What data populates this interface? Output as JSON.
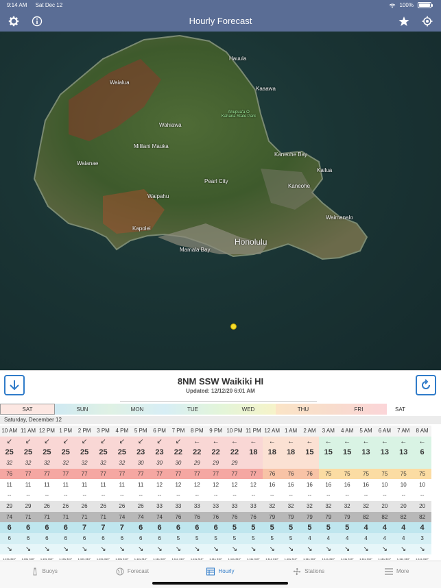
{
  "status_bar": {
    "time": "9:14 AM",
    "date": "Sat Dec 12",
    "battery": "100%"
  },
  "nav": {
    "title": "Hourly Forecast"
  },
  "map": {
    "labels": [
      {
        "text": "Hauula",
        "cls": ""
      },
      {
        "text": "Waialua",
        "cls": ""
      },
      {
        "text": "Kaaawa",
        "cls": ""
      },
      {
        "text": "Ahupua'a O Kahana State Park",
        "cls": "park"
      },
      {
        "text": "Wahiawa",
        "cls": ""
      },
      {
        "text": "Mililani Mauka",
        "cls": ""
      },
      {
        "text": "Kaneohe Bay",
        "cls": ""
      },
      {
        "text": "Waianae",
        "cls": ""
      },
      {
        "text": "Kailua",
        "cls": ""
      },
      {
        "text": "Pearl City",
        "cls": ""
      },
      {
        "text": "Kaneohe",
        "cls": ""
      },
      {
        "text": "Waipahu",
        "cls": ""
      },
      {
        "text": "Waimanalo",
        "cls": ""
      },
      {
        "text": "Kapolei",
        "cls": ""
      },
      {
        "text": "Honolulu",
        "cls": "big"
      },
      {
        "text": "Mamala Bay",
        "cls": ""
      }
    ],
    "highways": [
      "H2",
      "H3",
      "H1",
      "H201"
    ]
  },
  "station": {
    "name": "8NM SSW Waikiki HI",
    "updated": "Updated: 12/12/20 6:01 AM"
  },
  "days": [
    "SAT",
    "SUN",
    "MON",
    "TUE",
    "WED",
    "THU",
    "FRI",
    "SAT"
  ],
  "date_label": "Saturday, December 12",
  "table": {
    "hours": [
      "10 AM",
      "11 AM",
      "12 PM",
      "1 PM",
      "2 PM",
      "3 PM",
      "4 PM",
      "5 PM",
      "6 PM",
      "7 PM",
      "8 PM",
      "9 PM",
      "10 PM",
      "11 PM",
      "12 AM",
      "1 AM",
      "2 AM",
      "3 AM",
      "4 AM",
      "5 AM",
      "6 AM",
      "7 AM",
      "8 AM"
    ],
    "wind_dir": [
      "↙",
      "↙",
      "↙",
      "↙",
      "↙",
      "↙",
      "↙",
      "↙",
      "↙",
      "↙",
      "←",
      "←",
      "←",
      "←",
      "←",
      "←",
      "←",
      "←",
      "←",
      "←",
      "←",
      "←",
      "←"
    ],
    "wind_speed": [
      "25",
      "25",
      "25",
      "25",
      "25",
      "25",
      "25",
      "23",
      "23",
      "22",
      "22",
      "22",
      "22",
      "18",
      "18",
      "18",
      "15",
      "15",
      "15",
      "13",
      "13",
      "13",
      "6"
    ],
    "wind_gust": [
      "32",
      "32",
      "32",
      "32",
      "32",
      "32",
      "32",
      "30",
      "30",
      "30",
      "29",
      "29",
      "29",
      "",
      "",
      "",
      "",
      "",
      "",
      "",
      "",
      "",
      ""
    ],
    "air_temp": [
      "76",
      "77",
      "77",
      "77",
      "77",
      "77",
      "77",
      "77",
      "77",
      "77",
      "77",
      "77",
      "77",
      "77",
      "76",
      "76",
      "76",
      "75",
      "75",
      "75",
      "75",
      "75",
      "75"
    ],
    "row5": [
      "11",
      "11",
      "11",
      "11",
      "11",
      "11",
      "11",
      "11",
      "12",
      "12",
      "12",
      "12",
      "12",
      "12",
      "16",
      "16",
      "16",
      "16",
      "16",
      "16",
      "10",
      "10",
      "10"
    ],
    "row6": [
      "--",
      "--",
      "--",
      "--",
      "--",
      "--",
      "--",
      "--",
      "--",
      "--",
      "--",
      "--",
      "--",
      "--",
      "--",
      "--",
      "--",
      "--",
      "--",
      "--",
      "--",
      "--",
      "--"
    ],
    "row7": [
      "29",
      "29",
      "26",
      "26",
      "26",
      "26",
      "26",
      "26",
      "33",
      "33",
      "33",
      "33",
      "33",
      "33",
      "32",
      "32",
      "32",
      "32",
      "32",
      "32",
      "20",
      "20",
      "20"
    ],
    "row8": [
      "74",
      "71",
      "71",
      "71",
      "71",
      "71",
      "74",
      "74",
      "74",
      "76",
      "76",
      "76",
      "76",
      "76",
      "79",
      "79",
      "79",
      "79",
      "79",
      "82",
      "82",
      "82",
      "82"
    ],
    "wave_height": [
      "6",
      "6",
      "6",
      "6",
      "7",
      "7",
      "7",
      "6",
      "6",
      "6",
      "6",
      "6",
      "5",
      "5",
      "5",
      "5",
      "5",
      "5",
      "5",
      "4",
      "4",
      "4",
      "4"
    ],
    "wave_period": [
      "6",
      "6",
      "6",
      "6",
      "6",
      "6",
      "6",
      "6",
      "6",
      "5",
      "5",
      "5",
      "5",
      "5",
      "5",
      "5",
      "4",
      "4",
      "4",
      "4",
      "4",
      "4",
      "3"
    ],
    "swell_dir": [
      "↘",
      "↘",
      "↘",
      "↘",
      "↘",
      "↘",
      "↘",
      "↘",
      "↘",
      "↘",
      "↘",
      "↘",
      "↘",
      "↘",
      "↘",
      "↘",
      "↘",
      "↘",
      "↘",
      "↘",
      "↘",
      "↘",
      "↘"
    ],
    "swell_a": [
      "1.10s 310°",
      "1.10s 310°",
      "1.10s 310°",
      "1.10s 310°",
      "1.10s 310°",
      "1.10s 310°",
      "1.10s 310°",
      "1.11s 310°",
      "1.11s 310°",
      "1.11s 310°",
      "1.11s 310°",
      "1.11s 310°",
      "1.11s 310°",
      "1.11s 310°",
      "1.11s 310°",
      "1.11s 310°",
      "1.11s 310°",
      "1.11s 310°",
      "1.11s 310°",
      "1.11s 310°",
      "1.11s 310°",
      "1.11s 310°",
      "1.11s 310°"
    ],
    "swell_b": [
      "1.14s 220°",
      "1.14s 220°",
      "1.14s 220°",
      "1.14s 220°",
      "1.14s 220°",
      "1.14s 220°",
      "1.14s 220°",
      "1.14s 220°",
      "1.14s 220°",
      "1.14s 220°",
      "1.14s 220°",
      "1.14s 220°",
      "1.14s 220°",
      "1.14s 220°",
      "1.14s 220°",
      "1.14s 220°",
      "1.14s 220°",
      "1.14s 220°",
      "1.14s 220°",
      "1.14s 220°",
      "1.13s 220°",
      "1.13s 220°",
      "1.13s 220°"
    ]
  },
  "tabs": [
    "Buoys",
    "Forecast",
    "Hourly",
    "Stations",
    "More"
  ],
  "colors": {
    "nav": "#5a6d95",
    "accent": "#2f7bc9",
    "buoy": "#f7dc2a"
  }
}
